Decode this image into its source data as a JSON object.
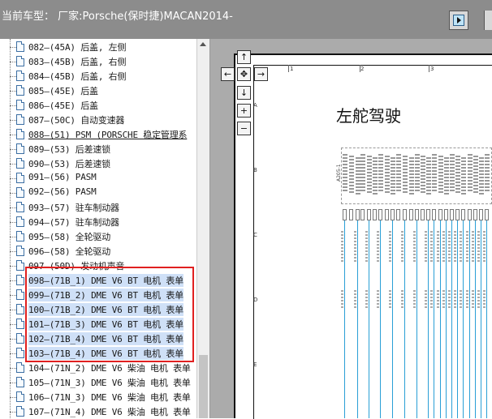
{
  "header": {
    "title": "当前车型： 厂家:Porsche(保时捷)MACAN2014-"
  },
  "tree": {
    "items": [
      {
        "label": "082—(45A) 后盖, 左侧"
      },
      {
        "label": "083—(45B) 后盖, 右侧"
      },
      {
        "label": "084—(45B) 后盖, 右侧"
      },
      {
        "label": "085—(45E) 后盖"
      },
      {
        "label": "086—(45E) 后盖"
      },
      {
        "label": "087—(50C) 自动变速器"
      },
      {
        "label": "088—(51) PSM (PORSCHE 稳定管理系"
      },
      {
        "label": "089—(53) 后差速锁"
      },
      {
        "label": "090—(53) 后差速锁"
      },
      {
        "label": "091—(56) PASM"
      },
      {
        "label": "092—(56) PASM"
      },
      {
        "label": "093—(57) 驻车制动器"
      },
      {
        "label": "094—(57) 驻车制动器"
      },
      {
        "label": "095—(58) 全轮驱动"
      },
      {
        "label": "096—(58) 全轮驱动"
      },
      {
        "label": "097—(50D) 发动机声音"
      },
      {
        "label": "098—(71B_1) DME V6 BT 电机 表单"
      },
      {
        "label": "099—(71B_2) DME V6 BT 电机 表单"
      },
      {
        "label": "100—(71B_2) DME V6 BT 电机 表单"
      },
      {
        "label": "101—(71B_3) DME V6 BT 电机 表单"
      },
      {
        "label": "102—(71B_4) DME V6 BT 电机 表单"
      },
      {
        "label": "103—(71B_4) DME V6 BT 电机 表单"
      },
      {
        "label": "104—(71N_2) DME V6 柴油 电机 表单"
      },
      {
        "label": "105—(71N_3) DME V6 柴油 电机 表单"
      },
      {
        "label": "106—(71N_3) DME V6 柴油 电机 表单"
      },
      {
        "label": "107—(71N_4) DME V6 柴油 电机 表单"
      }
    ]
  },
  "diagram": {
    "title": "左舵驾驶",
    "column_numbers": [
      "1",
      "2",
      "3"
    ],
    "row_letters": [
      "A",
      "B",
      "C",
      "D",
      "E"
    ],
    "sheet_code": "A205-1"
  },
  "nav": {
    "up": "↑",
    "left": "←",
    "center": "✥",
    "right": "→",
    "down": "↓",
    "zoom_in": "+",
    "zoom_out": "−"
  },
  "colors": {
    "header_bg": "#8c8c8c",
    "wire": "#2a9fd6",
    "highlight": "#e02020",
    "selection": "#cfe0f7"
  }
}
